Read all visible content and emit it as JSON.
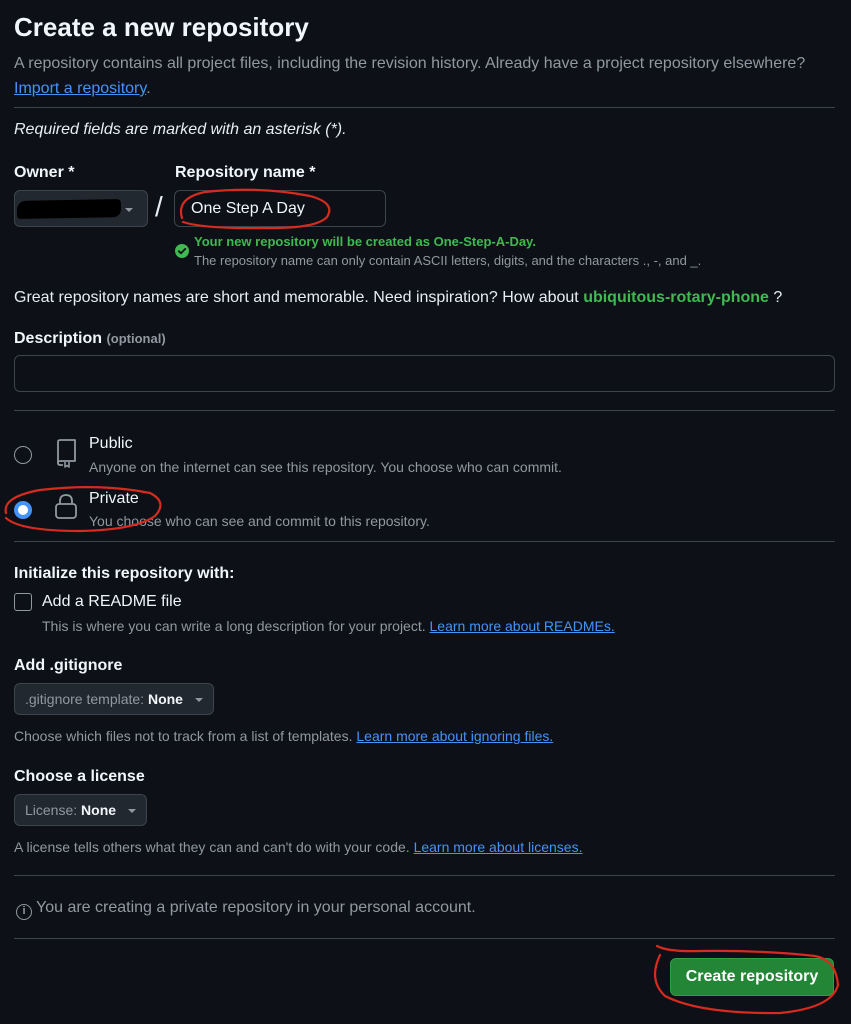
{
  "header": {
    "title": "Create a new repository",
    "intro_text": "A repository contains all project files, including the revision history. Already have a project repository elsewhere?",
    "import_link": "Import a repository",
    "intro_end": "."
  },
  "required_note": "Required fields are marked with an asterisk (*).",
  "owner": {
    "label": "Owner *"
  },
  "repo_name": {
    "label": "Repository name *",
    "value": "One Step A Day",
    "success": "Your new repository will be created as One-Step-A-Day.",
    "hint": "The repository name can only contain ASCII letters, digits, and the characters ., -, and _."
  },
  "separator": "/",
  "suggestion": {
    "text": "Great repository names are short and memorable. Need inspiration? How about",
    "name": "ubiquitous-rotary-phone",
    "end": " ?"
  },
  "description": {
    "label": "Description",
    "optional": "(optional)",
    "value": ""
  },
  "visibility": {
    "public": {
      "title": "Public",
      "sub": "Anyone on the internet can see this repository. You choose who can commit.",
      "selected": false
    },
    "private": {
      "title": "Private",
      "sub": "You choose who can see and commit to this repository.",
      "selected": true
    }
  },
  "init": {
    "label": "Initialize this repository with:",
    "readme_label": "Add a README file",
    "readme_sub": "This is where you can write a long description for your project.",
    "readme_link": "Learn more about READMEs.",
    "readme_checked": false
  },
  "gitignore": {
    "label": "Add .gitignore",
    "prefix": ".gitignore template:",
    "value": "None",
    "sub": "Choose which files not to track from a list of templates.",
    "link": "Learn more about ignoring files."
  },
  "license": {
    "label": "Choose a license",
    "prefix": "License:",
    "value": "None",
    "sub": "A license tells others what they can and can't do with your code.",
    "link": "Learn more about licenses."
  },
  "info_note": "You are creating a private repository in your personal account.",
  "submit": {
    "label": "Create repository"
  },
  "colors": {
    "background": "#0d1117",
    "success": "#3fb950",
    "link": "#4493f8",
    "primary_button": "#238636",
    "annotation": "#d62b1e"
  },
  "icons": [
    "caret-down-icon",
    "check-circle-icon",
    "repo-icon",
    "lock-icon",
    "info-icon"
  ]
}
